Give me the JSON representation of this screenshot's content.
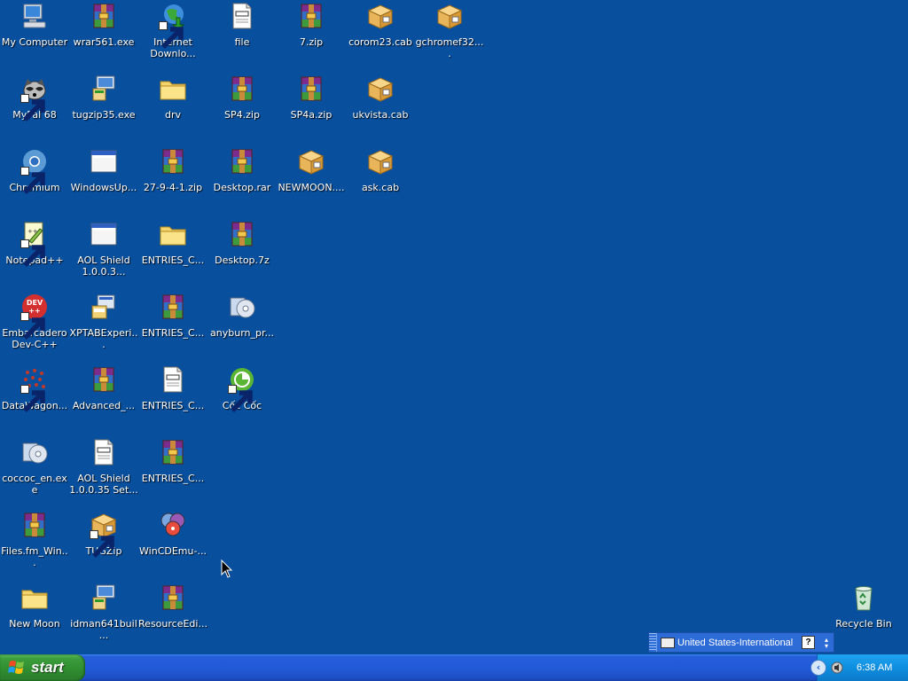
{
  "desktop": {
    "background_color": "#084f9d",
    "icons": [
      {
        "label": "My Computer",
        "icon": "computer-icon",
        "shortcut": false
      },
      {
        "label": "wrar561.exe",
        "icon": "winrar-icon",
        "shortcut": false
      },
      {
        "label": "Internet Downlo...",
        "icon": "globe-download-icon",
        "shortcut": true
      },
      {
        "label": "file",
        "icon": "text-file-icon",
        "shortcut": false
      },
      {
        "label": "7.zip",
        "icon": "winrar-icon",
        "shortcut": false
      },
      {
        "label": "corom23.cab",
        "icon": "cab-box-icon",
        "shortcut": false
      },
      {
        "label": "gchromef32....",
        "icon": "cab-box-icon",
        "shortcut": false
      },
      {
        "label": "MyPal 68",
        "icon": "raccoon-icon",
        "shortcut": true
      },
      {
        "label": "tugzip35.exe",
        "icon": "installer-icon",
        "shortcut": false
      },
      {
        "label": "drv",
        "icon": "folder-icon",
        "shortcut": false
      },
      {
        "label": "SP4.zip",
        "icon": "winrar-icon",
        "shortcut": false
      },
      {
        "label": "SP4a.zip",
        "icon": "winrar-icon",
        "shortcut": false
      },
      {
        "label": "ukvista.cab",
        "icon": "cab-box-icon",
        "shortcut": false
      },
      {
        "label": "Chromium",
        "icon": "chromium-icon",
        "shortcut": true
      },
      {
        "label": "WindowsUp...",
        "icon": "window-icon",
        "shortcut": false
      },
      {
        "label": "27-9-4-1.zip",
        "icon": "winrar-icon",
        "shortcut": false
      },
      {
        "label": "Desktop.rar",
        "icon": "winrar-icon",
        "shortcut": false
      },
      {
        "label": "NEWMOON....",
        "icon": "cab-box-icon",
        "shortcut": false
      },
      {
        "label": "ask.cab",
        "icon": "cab-box-icon",
        "shortcut": false
      },
      {
        "label": "Notepad++",
        "icon": "notepad-icon",
        "shortcut": true
      },
      {
        "label": "AOL Shield 1.0.0.3...",
        "icon": "window-icon",
        "shortcut": false
      },
      {
        "label": "ENTRIES_C...",
        "icon": "folder-icon",
        "shortcut": false
      },
      {
        "label": "Desktop.7z",
        "icon": "winrar-icon",
        "shortcut": false
      },
      {
        "label": "Embarcadero Dev-C++",
        "icon": "devcpp-icon",
        "shortcut": true
      },
      {
        "label": "XPTABExperi...",
        "icon": "setup-icon",
        "shortcut": false
      },
      {
        "label": "ENTRIES_C...",
        "icon": "winrar-icon",
        "shortcut": false
      },
      {
        "label": "anyburn_pr...",
        "icon": "disc-installer-icon",
        "shortcut": false
      },
      {
        "label": "DataWagon...",
        "icon": "dots-icon",
        "shortcut": true
      },
      {
        "label": "Advanced_...",
        "icon": "winrar-icon",
        "shortcut": false
      },
      {
        "label": "ENTRIES_C...",
        "icon": "text-file-icon",
        "shortcut": false
      },
      {
        "label": "Cốc Cốc",
        "icon": "coccoc-icon",
        "shortcut": true
      },
      {
        "label": "coccoc_en.exe",
        "icon": "disc-installer-icon",
        "shortcut": false
      },
      {
        "label": "AOL Shield 1.0.0.35 Set...",
        "icon": "text-file-icon",
        "shortcut": false
      },
      {
        "label": "ENTRIES_C...",
        "icon": "winrar-icon",
        "shortcut": false
      },
      {
        "label": "Files.fm_Win...",
        "icon": "winrar-icon",
        "shortcut": false
      },
      {
        "label": "TUGZip",
        "icon": "cab-box-icon",
        "shortcut": true
      },
      {
        "label": "WinCDEmu-...",
        "icon": "discs-icon",
        "shortcut": false
      },
      {
        "label": "New Moon",
        "icon": "folder-icon",
        "shortcut": false
      },
      {
        "label": "idman641buil...",
        "icon": "installer-icon",
        "shortcut": false
      },
      {
        "label": "ResourceEdi...",
        "icon": "winrar-icon",
        "shortcut": false
      },
      {
        "label": "Recycle Bin",
        "icon": "recycle-bin-icon",
        "shortcut": false
      }
    ]
  },
  "language_bar": {
    "language": "United States-International",
    "help_label": "?"
  },
  "taskbar": {
    "start_label": "start",
    "clock": "6:38 AM",
    "tray_arrow": "‹"
  }
}
